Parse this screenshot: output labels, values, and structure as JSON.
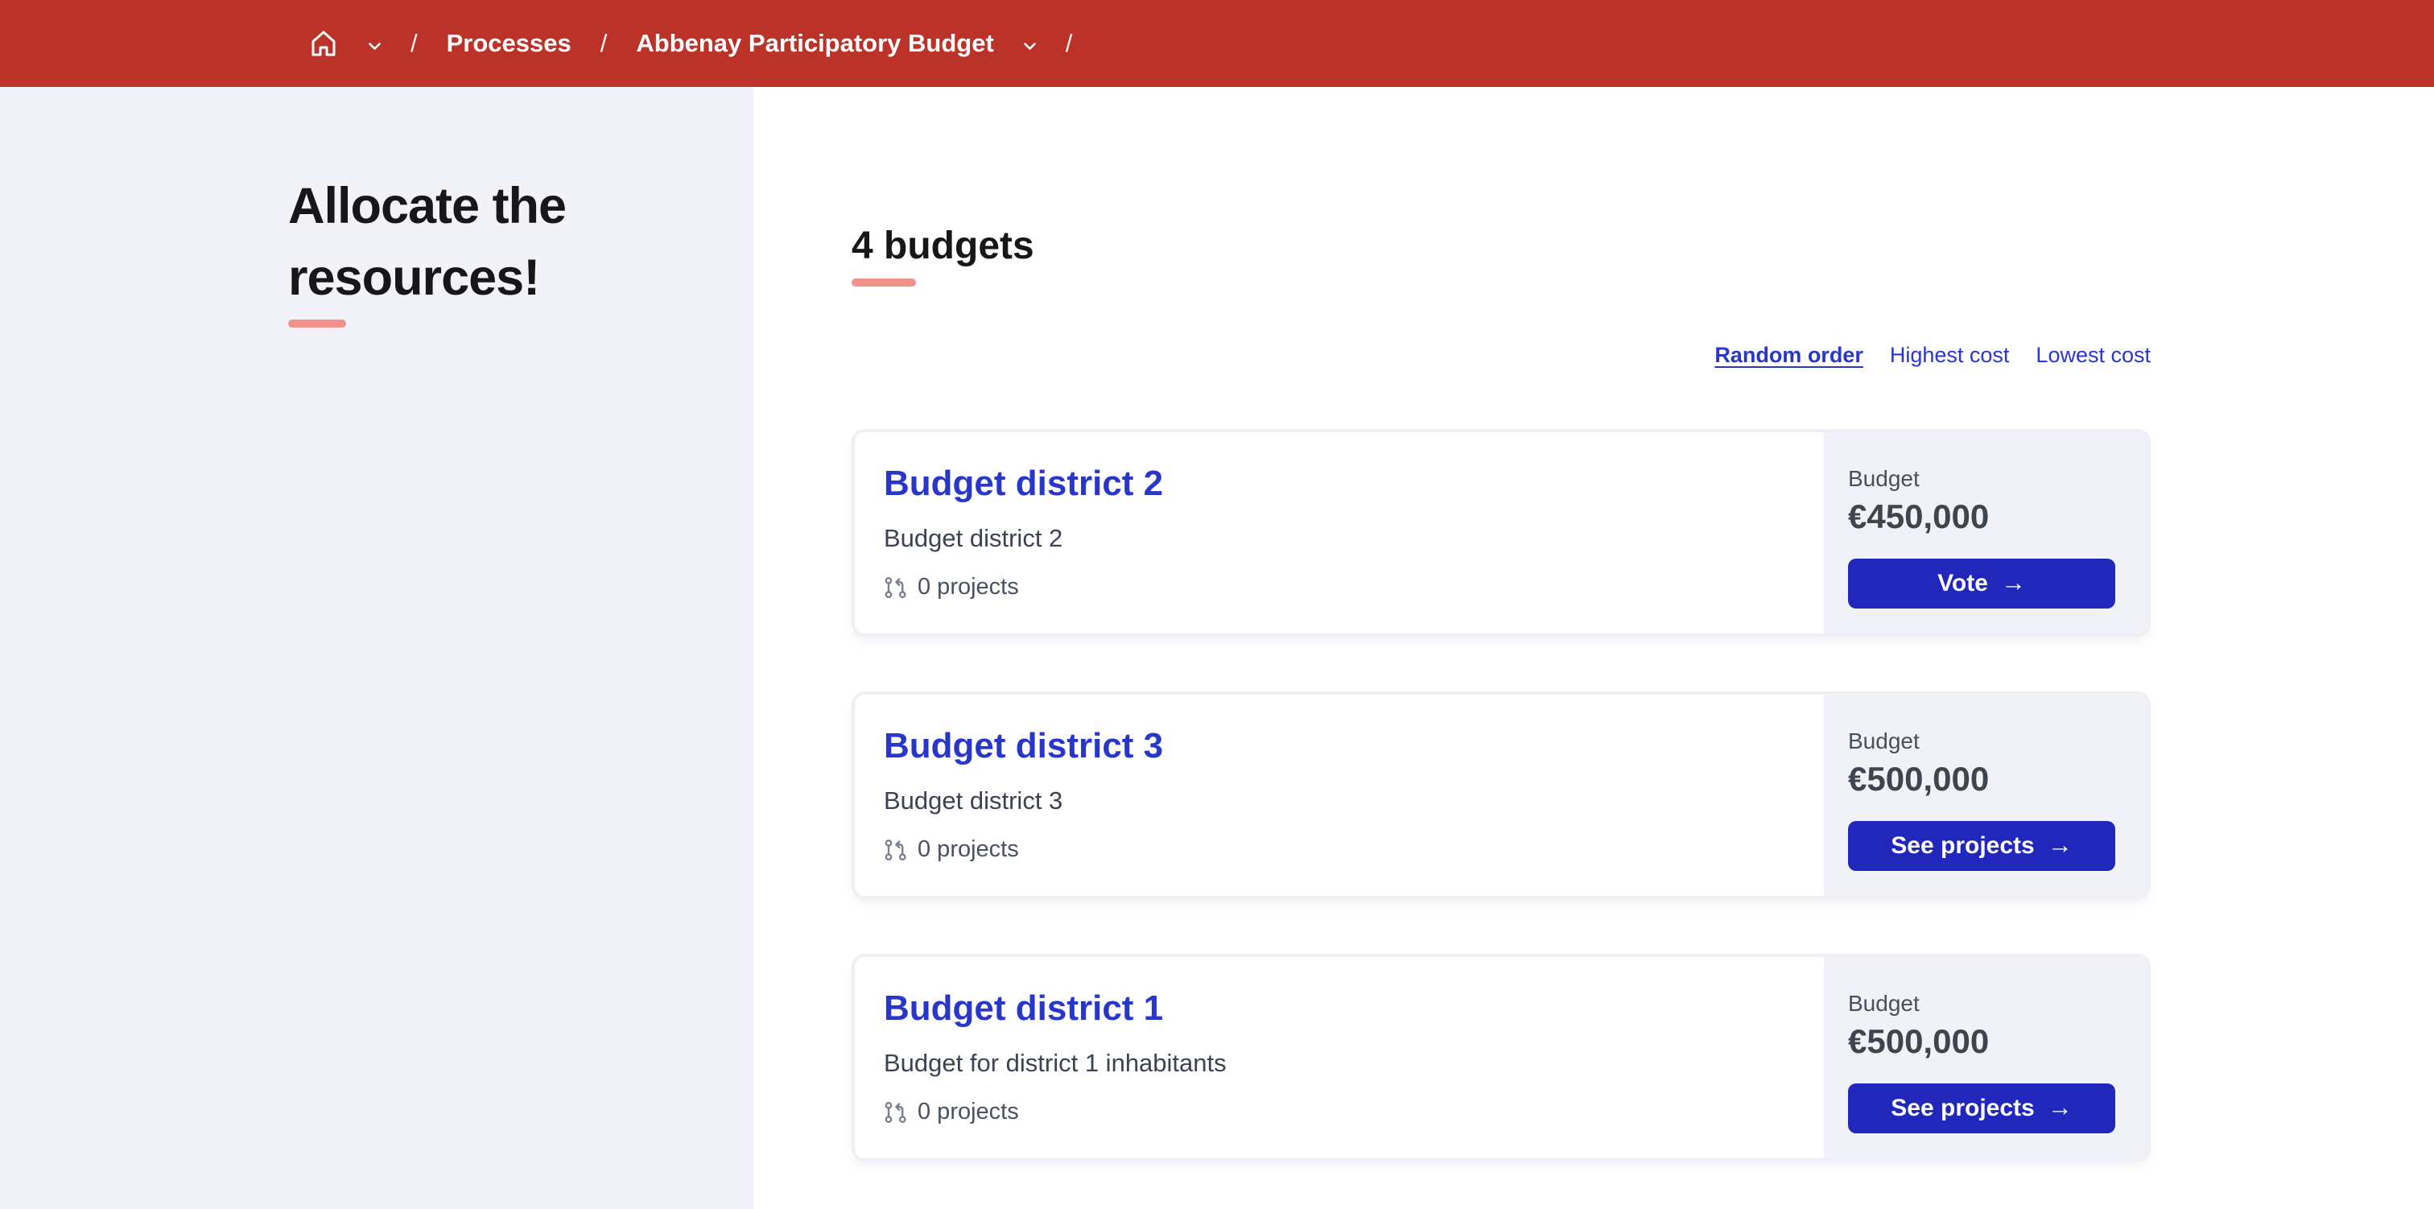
{
  "colors": {
    "header-bg": "#bb3328",
    "sidebar-bg": "#f2f3f8",
    "panel-bg": "#f1f2f7",
    "card-border": "#eef0f6",
    "accent": "#f0918a",
    "link": "#2836c9",
    "button": "#2127bb",
    "heading-text": "#17171a",
    "body-text": "#3b4252",
    "slate": "#3e4450",
    "muted": "#6e7787"
  },
  "header": {
    "breadcrumb": {
      "separator": "/",
      "items": [
        {
          "label": "Processes"
        },
        {
          "label": "Abbenay Participatory Budget"
        }
      ]
    }
  },
  "sidebar": {
    "title": "Allocate the resources!"
  },
  "main": {
    "heading": "4 budgets",
    "sort": {
      "options": [
        {
          "label": "Random order",
          "active": true
        },
        {
          "label": "Highest cost",
          "active": false
        },
        {
          "label": "Lowest cost",
          "active": false
        }
      ]
    },
    "cards": [
      {
        "title": "Budget district 2",
        "description": "Budget district 2",
        "projects_count": "0 projects",
        "budget_label": "Budget",
        "amount": "€450,000",
        "action_label": "Vote"
      },
      {
        "title": "Budget district 3",
        "description": "Budget district 3",
        "projects_count": "0 projects",
        "budget_label": "Budget",
        "amount": "€500,000",
        "action_label": "See projects"
      },
      {
        "title": "Budget district 1",
        "description": "Budget for district 1 inhabitants",
        "projects_count": "0 projects",
        "budget_label": "Budget",
        "amount": "€500,000",
        "action_label": "See projects"
      }
    ]
  },
  "icons": {
    "arrow_right": "→"
  }
}
